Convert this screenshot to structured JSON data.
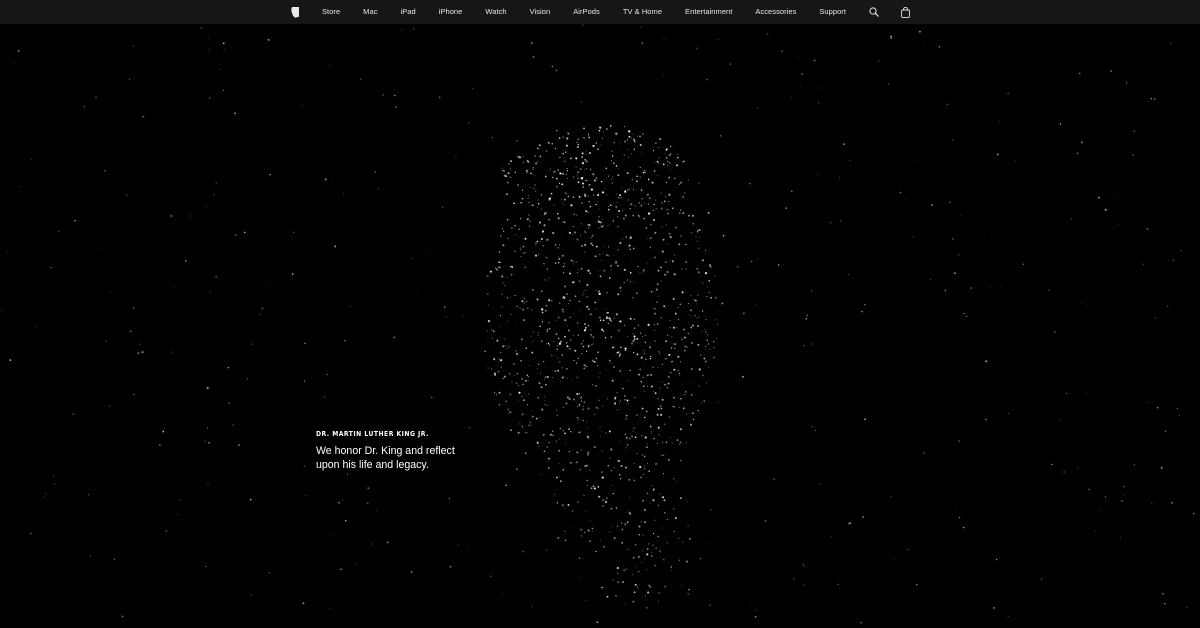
{
  "nav": {
    "apple_logo_icon": "apple-logo-icon",
    "items": [
      {
        "label": "Store"
      },
      {
        "label": "Mac"
      },
      {
        "label": "iPad"
      },
      {
        "label": "iPhone"
      },
      {
        "label": "Watch"
      },
      {
        "label": "Vision"
      },
      {
        "label": "AirPods"
      },
      {
        "label": "TV & Home"
      },
      {
        "label": "Entertainment"
      },
      {
        "label": "Accessories"
      },
      {
        "label": "Support"
      }
    ],
    "search_icon": "search-icon",
    "bag_icon": "shopping-bag-icon",
    "background": "#161617",
    "text_color": "#e8e8ed"
  },
  "hero": {
    "eyebrow": "DR. MARTIN LUTHER KING JR.",
    "headline": "We honor Dr. King and reflect upon his life and legacy.",
    "background": "#000000",
    "text_color": "#ffffff"
  }
}
